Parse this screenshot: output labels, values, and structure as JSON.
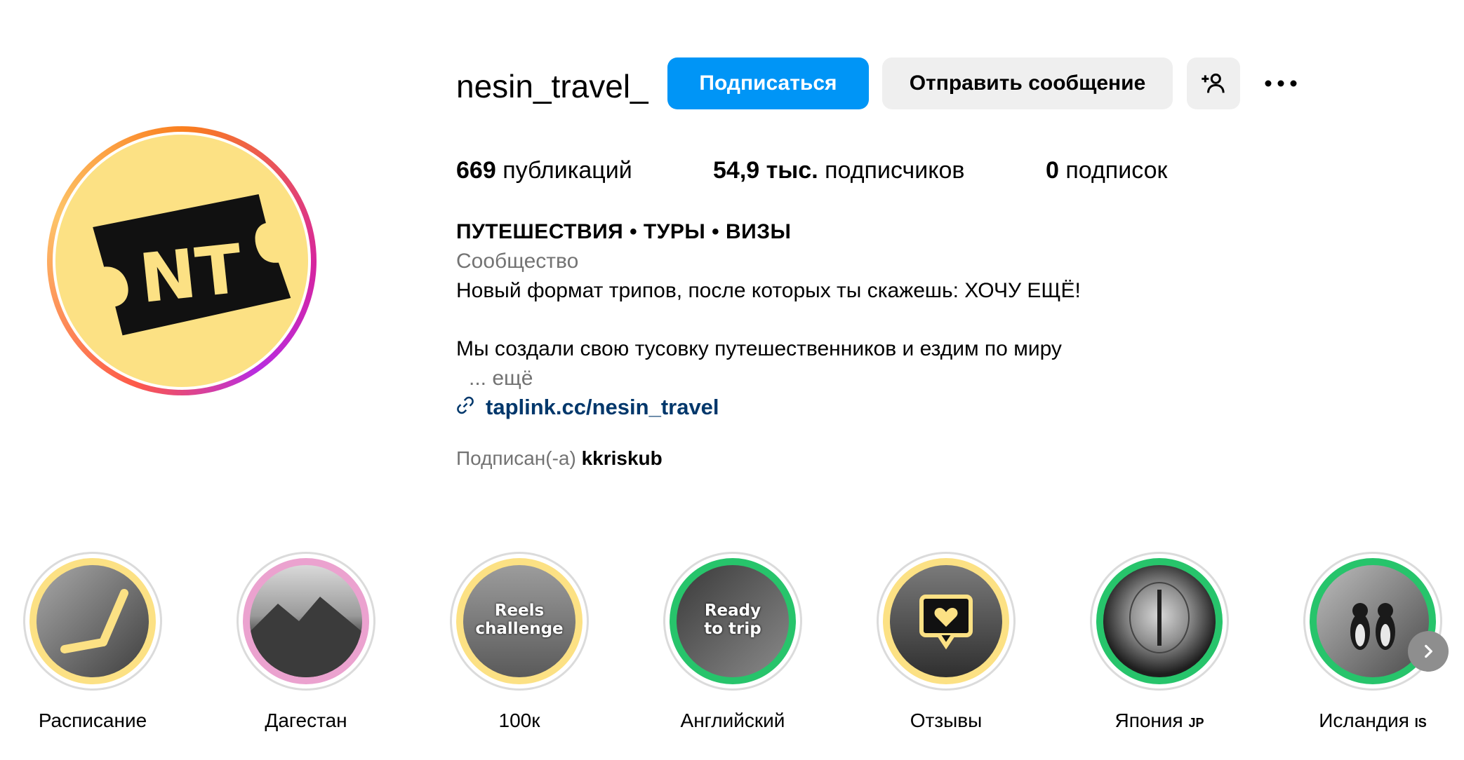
{
  "profile": {
    "username": "nesin_travel_",
    "avatar_text": "NT",
    "buttons": {
      "follow": "Подписаться",
      "message": "Отправить сообщение",
      "add_user_icon": "add-user-icon",
      "more_icon": "more-options-icon"
    },
    "stats": {
      "posts_count": "669",
      "posts_label": "публикаций",
      "followers_count": "54,9 тыс.",
      "followers_label": "подписчиков",
      "following_count": "0",
      "following_label": "подписок"
    },
    "bio": {
      "name": "ПУТЕШЕСТВИЯ • ТУРЫ • ВИЗЫ",
      "category": "Сообщество",
      "line1": "Новый формат трипов, после которых ты скажешь: ХОЧУ ЕЩЁ!",
      "line2": "Мы создали свою тусовку путешественников и ездим по миру",
      "more": "... ещё",
      "link": "taplink.cc/nesin_travel"
    },
    "followed_by": {
      "prefix": "Подписан(-а)",
      "user": "kkriskub"
    }
  },
  "highlights": [
    {
      "label": "Расписание",
      "suffix": "",
      "ring_color": "#fce184"
    },
    {
      "label": "Дагестан",
      "suffix": "",
      "ring_color": "#eba2cf"
    },
    {
      "label": "100к",
      "suffix": "",
      "ring_color": "#fce184",
      "overlay": "Reels\nchallenge"
    },
    {
      "label": "Английский",
      "suffix": "",
      "ring_color": "#27c46b",
      "overlay": "Ready\nto trip"
    },
    {
      "label": "Отзывы",
      "suffix": "",
      "ring_color": "#fce184"
    },
    {
      "label": "Япония",
      "suffix": "JP",
      "ring_color": "#27c46b"
    },
    {
      "label": "Исландия",
      "suffix": "IS",
      "ring_color": "#27c46b"
    }
  ],
  "colors": {
    "accent": "#0095f6",
    "link": "#00376b",
    "secondary_text": "#737373",
    "avatar_bg": "#fce184"
  }
}
